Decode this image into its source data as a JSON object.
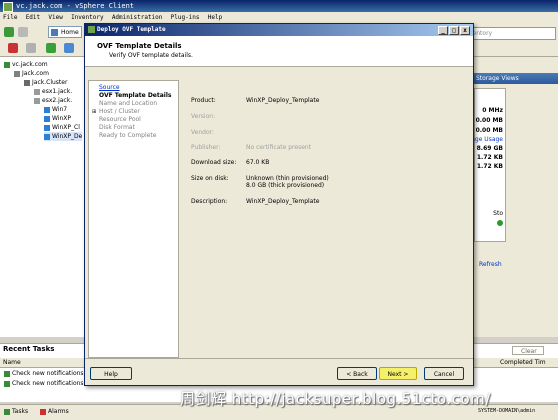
{
  "app": {
    "window_title": "vc.jack.com - vSphere Client",
    "menu": [
      "File",
      "Edit",
      "View",
      "Inventory",
      "Administration",
      "Plug-ins",
      "Help"
    ],
    "home_label": "Home",
    "search_placeholder": "ventory"
  },
  "tree": {
    "items": [
      {
        "label": "vc.jack.com",
        "icon": "vcenter-icon"
      },
      {
        "label": "Jack.com",
        "icon": "datacenter-icon"
      },
      {
        "label": "Jack.Cluster",
        "icon": "cluster-icon"
      },
      {
        "label": "esx1.jack.",
        "icon": "host-icon"
      },
      {
        "label": "esx2.jack.",
        "icon": "host-icon"
      },
      {
        "label": "Win7",
        "icon": "vm-icon"
      },
      {
        "label": "WinXP",
        "icon": "vm-icon"
      },
      {
        "label": "WinXP_Cl",
        "icon": "vm-icon"
      },
      {
        "label": "WinXP_De",
        "icon": "vm-icon"
      }
    ]
  },
  "right_panel": {
    "tab_label": "Storage Views",
    "stats": [
      "0 MHz",
      "0.00 MB",
      "0.00 MB",
      "age Usage",
      "8.69 GB",
      "1.72 KB",
      "1.72 KB"
    ],
    "field_label": "Sto",
    "refresh_label": "Refresh"
  },
  "dialog": {
    "title": "Deploy OVF Template",
    "heading": "OVF Template Details",
    "subheading": "Verify OVF template details.",
    "steps": [
      {
        "label": "Source",
        "state": "link"
      },
      {
        "label": "OVF Template Details",
        "state": "current"
      },
      {
        "label": "Name and Location",
        "state": "pending"
      },
      {
        "label": "Host / Cluster",
        "state": "pending"
      },
      {
        "label": "Resource Pool",
        "state": "pending"
      },
      {
        "label": "Disk Format",
        "state": "pending"
      },
      {
        "label": "Ready to Complete",
        "state": "pending"
      }
    ],
    "details": {
      "product_label": "Product:",
      "product_value": "WinXP_Deploy_Template",
      "version_label": "Version:",
      "vendor_label": "Vendor:",
      "publisher_label": "Publisher:",
      "publisher_value": "No certificate present",
      "download_label": "Download size:",
      "download_value": "67.0 KB",
      "disk_label": "Size on disk:",
      "disk_value_1": "Unknown (thin provisioned)",
      "disk_value_2": "8.0 GB (thick provisioned)",
      "description_label": "Description:",
      "description_value": "WinXP_Deploy_Template"
    },
    "buttons": {
      "help": "Help",
      "back": "< Back",
      "next": "Next >",
      "cancel": "Cancel"
    }
  },
  "recent_tasks": {
    "title": "Recent Tasks",
    "column_name": "Name",
    "column_completed": "Completed Tim",
    "rows": [
      "Check new notifications",
      "Check new notifications"
    ],
    "clear_label": "Clear"
  },
  "statusbar": {
    "tasks": "Tasks",
    "alarms": "Alarms",
    "user": "SYSTEM-DOMAIN\\admin"
  },
  "watermark": "周剑辉 http://jacksuper.blog.51cto.com/",
  "colors": {
    "title_bar": "#0a246a",
    "next_button": "#f5f06a",
    "vm_icon": "#2b7fd4"
  }
}
